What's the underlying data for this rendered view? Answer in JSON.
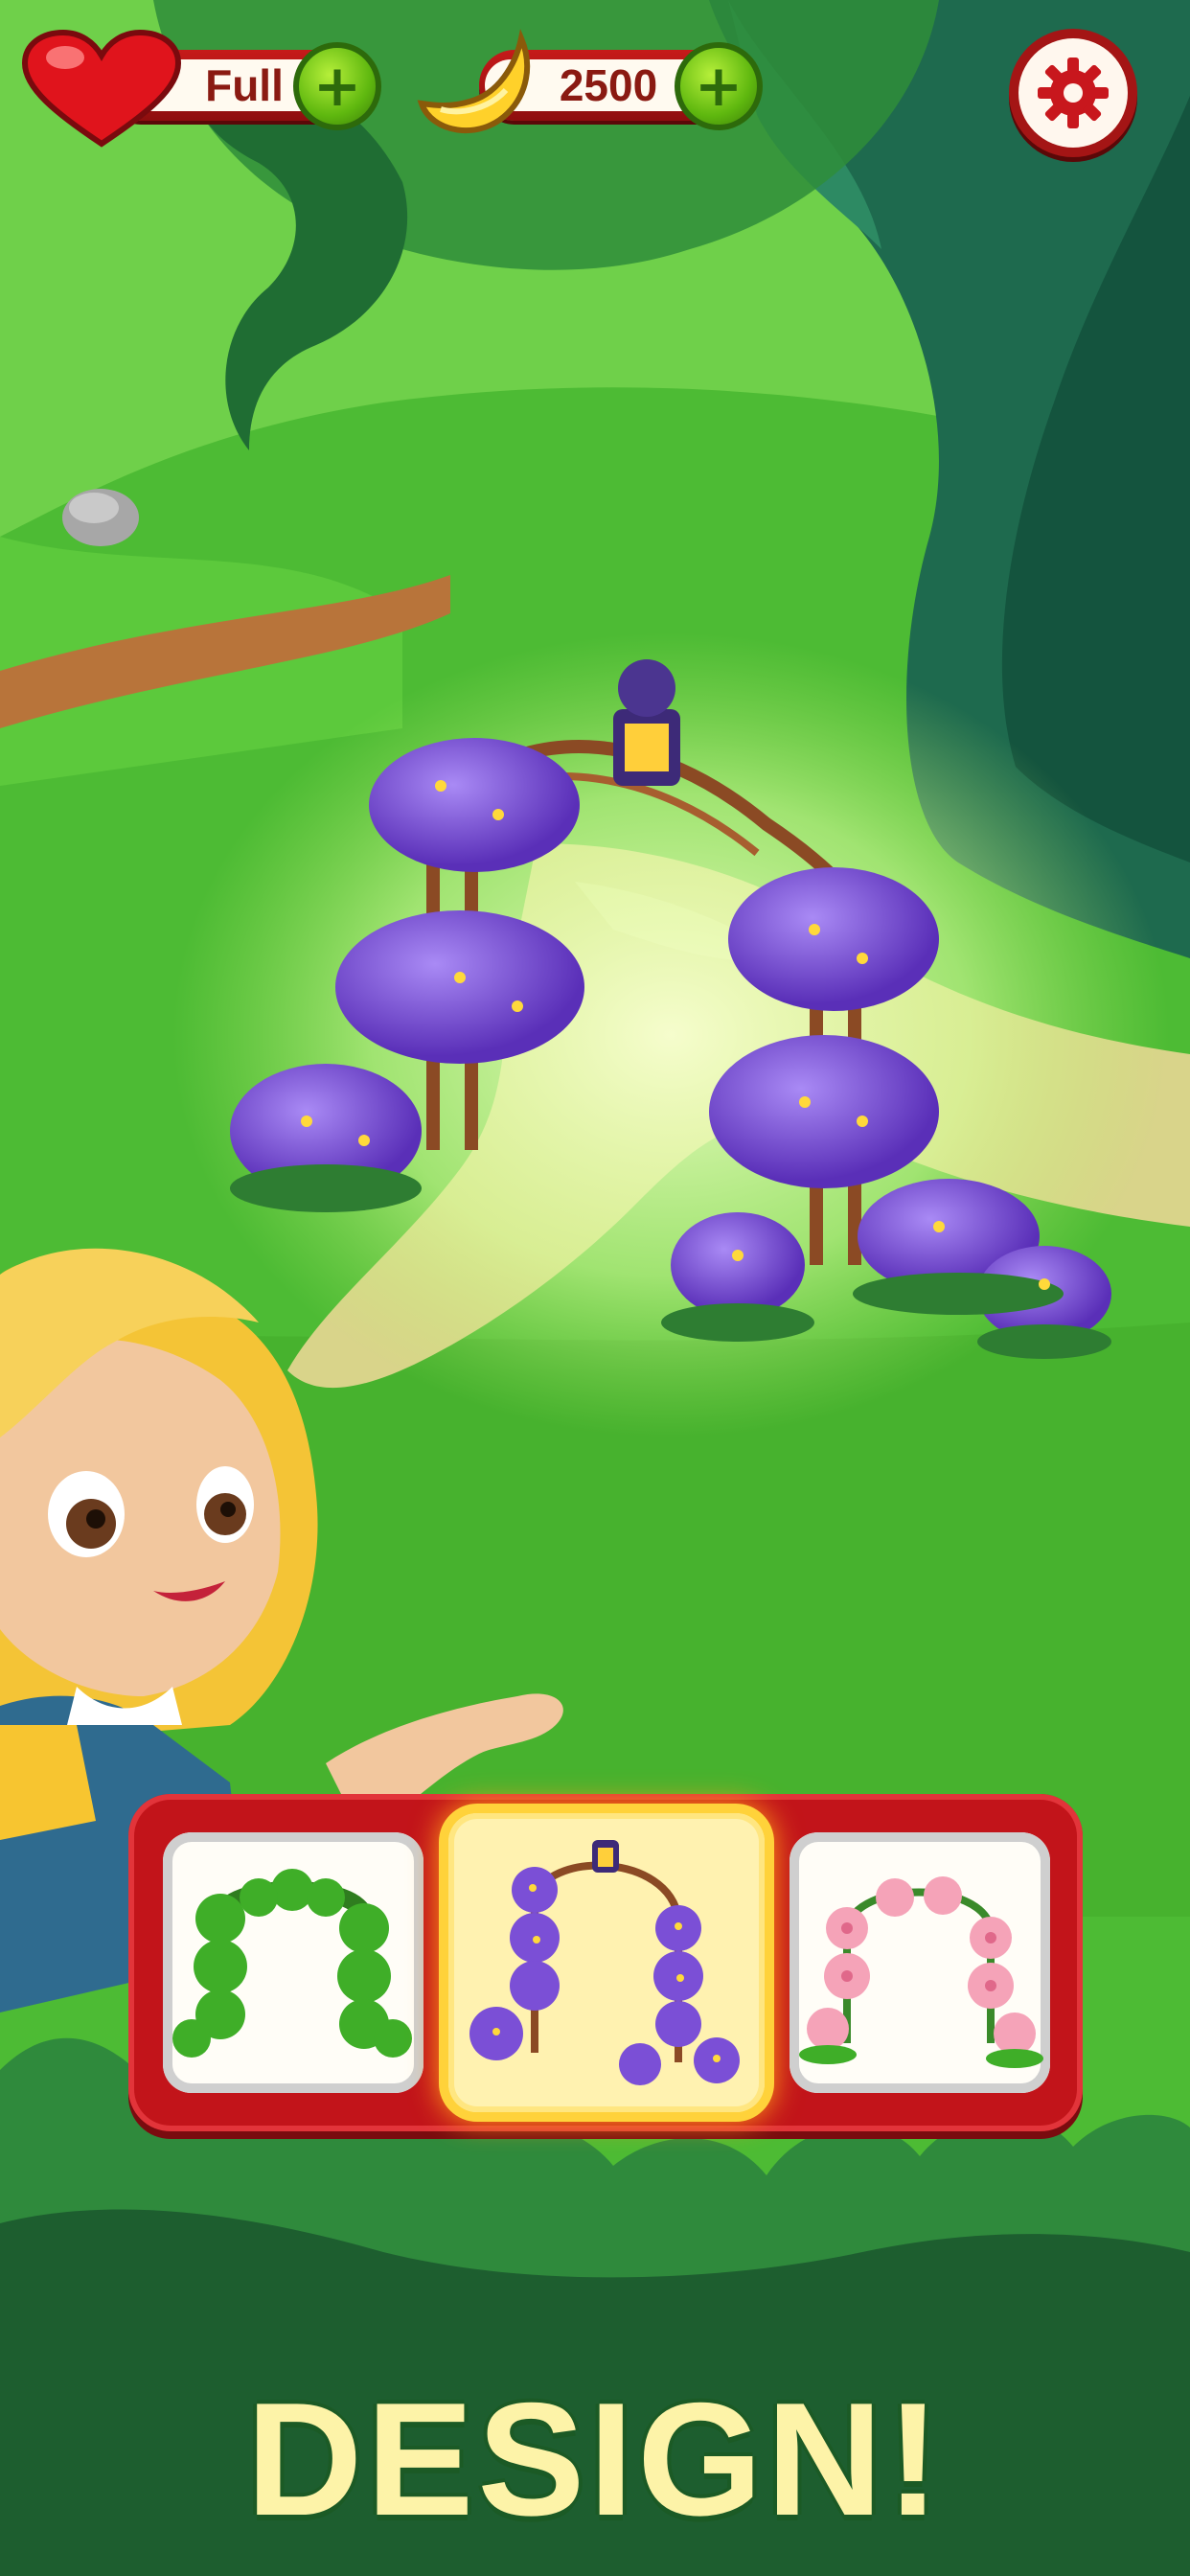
{
  "hud": {
    "lives_value": "Full",
    "currency_value": "2500"
  },
  "colors": {
    "grass": "#4fbf33",
    "panel_red": "#c2141a",
    "title_text": "#fdf3a8",
    "plus_green": "#5fb80f",
    "violet_flowers": "#7b4fd6",
    "pink_flowers": "#f5a3b8"
  },
  "design_options": [
    {
      "name": "green-topiary-arch",
      "selected": false
    },
    {
      "name": "violet-flower-arch",
      "selected": true
    },
    {
      "name": "pink-blossom-arch",
      "selected": false
    }
  ],
  "title": "DESIGN!"
}
